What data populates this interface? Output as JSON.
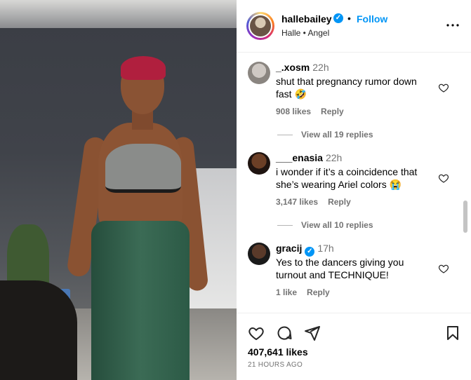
{
  "post": {
    "username": "hallebailey",
    "verified_mark": "✓",
    "separator": "•",
    "follow_label": "Follow",
    "audio": "Halle • Angel",
    "more_label": "•••",
    "likes": "407,641 likes",
    "posted": "21 HOURS AGO"
  },
  "comments": [
    {
      "username": "_.xosm",
      "time": "22h",
      "text": "shut that pregnancy rumor down fast 🤣",
      "likes": "908 likes",
      "reply": "Reply",
      "view_replies": "View all 19 replies"
    },
    {
      "username": "___enasia",
      "time": "22h",
      "text": "i wonder if it’s a coincidence that she’s wearing Ariel colors 😭",
      "likes": "3,147 likes",
      "reply": "Reply",
      "view_replies": "View all 10 replies"
    },
    {
      "username": "gracij",
      "verified_mark": "✓",
      "time": "17h",
      "text": "Yes to the dancers giving you turnout and TECHNIQUE!",
      "likes": "1 like",
      "reply": "Reply"
    }
  ],
  "icons": {
    "like": "heart-icon",
    "comment": "comment-icon",
    "share": "share-icon",
    "save": "bookmark-icon",
    "more": "more-icon"
  },
  "colors": {
    "follow": "#0095f6",
    "verified": "#0095f6",
    "meta": "#737373"
  }
}
